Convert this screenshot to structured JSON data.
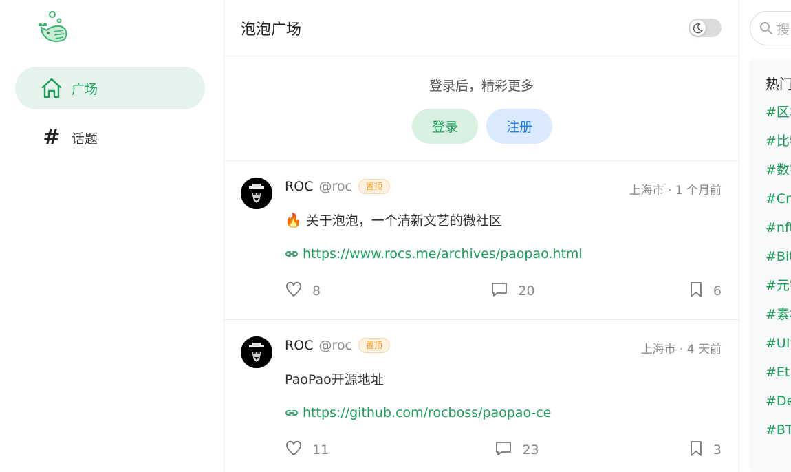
{
  "sidebar": {
    "items": [
      {
        "label": "广场",
        "icon": "home-icon",
        "active": true
      },
      {
        "label": "话题",
        "icon": "hash-icon",
        "active": false
      }
    ]
  },
  "header": {
    "title": "泡泡广场",
    "theme_toggle_icon": "moon-icon"
  },
  "login_box": {
    "prompt": "登录后，精彩更多",
    "login_label": "登录",
    "register_label": "注册"
  },
  "posts": [
    {
      "name": "ROC",
      "handle": "@roc",
      "badge": "置顶",
      "meta": "上海市 · 1 个月前",
      "text": "关于泡泡，一个清新文艺的微社区",
      "emoji": "🔥",
      "link": "https://www.rocs.me/archives/paopao.html",
      "likes": "8",
      "comments": "20",
      "bookmarks": "6"
    },
    {
      "name": "ROC",
      "handle": "@roc",
      "badge": "置顶",
      "meta": "上海市 · 4 天前",
      "text": "PaoPao开源地址",
      "link": "https://github.com/rocboss/paopao-ce",
      "likes": "11",
      "comments": "23",
      "bookmarks": "3"
    }
  ],
  "right": {
    "search_placeholder": "搜",
    "topics_title": "热门",
    "topics": [
      "#区块",
      "#比特",
      "#数字",
      "#Cry",
      "#nft",
      "#Bit",
      "#元宇",
      "#素材",
      "#UI设",
      "#Eth",
      "#De",
      "#BT"
    ]
  },
  "colors": {
    "accent": "#18a058",
    "register": "#2080f0",
    "badge": "#f0a020"
  }
}
